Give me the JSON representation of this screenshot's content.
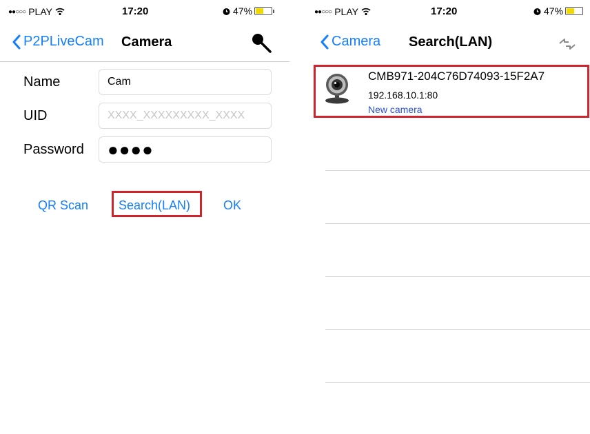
{
  "status": {
    "carrier": "PLAY",
    "time": "17:20",
    "battery": "47%"
  },
  "left": {
    "back_label": "P2PLiveCam",
    "title": "Camera",
    "fields": {
      "name_label": "Name",
      "name_value": "Cam",
      "uid_label": "UID",
      "uid_placeholder": "XXXX_XXXXXXXXX_XXXX",
      "password_label": "Password",
      "password_value": "●●●●"
    },
    "actions": {
      "qr_scan": "QR Scan",
      "search_lan": "Search(LAN)",
      "ok": "OK"
    }
  },
  "right": {
    "back_label": "Camera",
    "title": "Search(LAN)",
    "results": [
      {
        "name": "CMB971-204C76D74093-15F2A7",
        "ip": "192.168.10.1:80",
        "status": "New camera"
      }
    ]
  },
  "colors": {
    "accent": "#157efb",
    "highlight": "#d0232b",
    "battery": "#f2d900",
    "status_link": "#2a4fd8"
  },
  "icons": {
    "wifi": "wifi-icon",
    "alarm": "alarm-icon",
    "back": "chevron-left-icon",
    "search": "magnifier-icon",
    "refresh": "refresh-arrows-icon",
    "camera": "webcam-icon"
  }
}
